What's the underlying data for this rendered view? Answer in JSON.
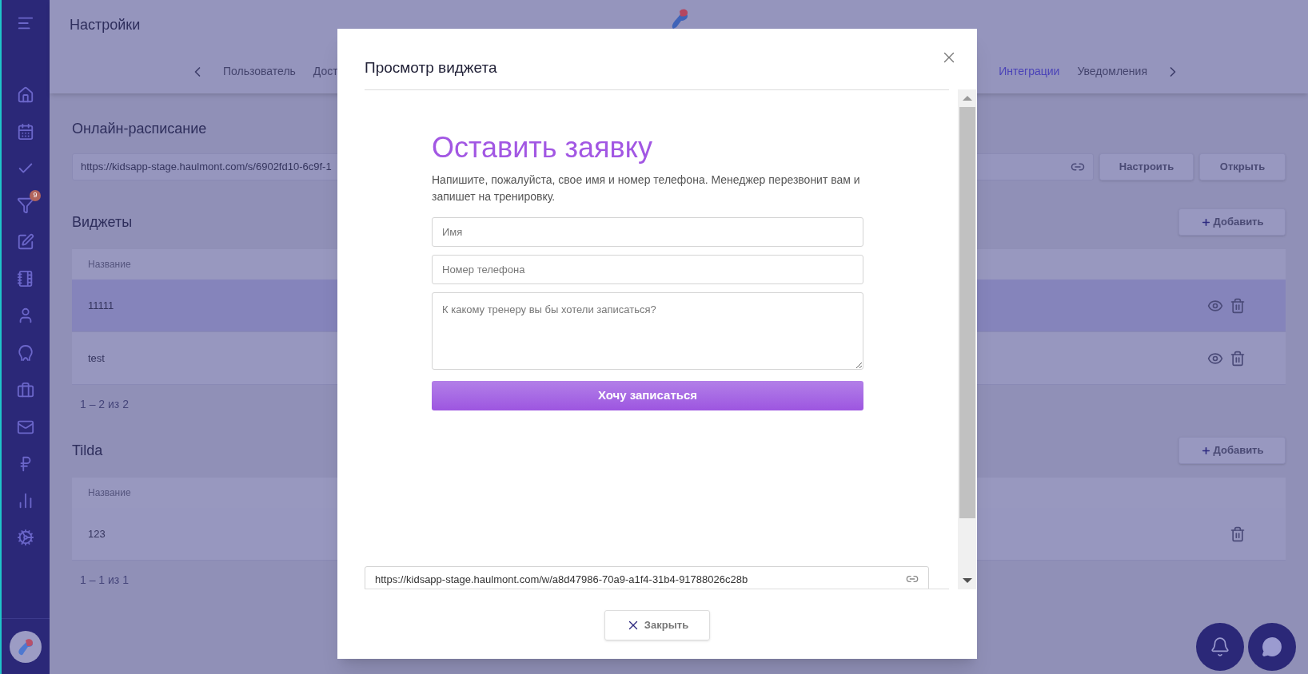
{
  "page": {
    "title": "Настройки"
  },
  "sidebar": {
    "badge": "9"
  },
  "tabs": [
    {
      "label": "Пользователь",
      "selected": false
    },
    {
      "label": "Дост",
      "selected": false
    },
    {
      "label": "Интеграции",
      "selected": true
    },
    {
      "label": "Уведомления",
      "selected": false
    }
  ],
  "online_schedule": {
    "title": "Онлайн-расписание",
    "url": "https://kidsapp-stage.haulmont.com/s/6902fd10-6c9f-1",
    "buttons": [
      "Настроить",
      "Открыть"
    ]
  },
  "widgets": {
    "title": "Виджеты",
    "add_button": "Добавить",
    "column": "Название",
    "pagination": "1 – 2 из 2",
    "rows": [
      {
        "name": "11111",
        "selected": true,
        "kind": "widget"
      },
      {
        "name": "test",
        "selected": false,
        "kind": "widget"
      }
    ]
  },
  "tilda": {
    "title": "Tilda",
    "add_button": "Добавить",
    "column": "Название",
    "pagination": "1 – 1 из 1",
    "rows": [
      {
        "name": "123",
        "selected": false,
        "kind": "tilda"
      }
    ]
  },
  "modal": {
    "title": "Просмотр виджета",
    "heading": "Оставить заявку",
    "text": "Напишите, пожалуйста, свое имя и номер телефона. Менеджер перезвонит вам и запишет на тренировку.",
    "fields": [
      {
        "placeholder": "Имя",
        "kind": "input"
      },
      {
        "placeholder": "Номер телефона",
        "kind": "input"
      },
      {
        "placeholder": "К какому тренеру вы бы хотели записаться?",
        "kind": "textarea"
      }
    ],
    "submit": "Хочу записаться",
    "link": "https://kidsapp-stage.haulmont.com/w/a8d47986-70a9-a1f4-31b4-91788026c28b",
    "close_button": "Закрыть"
  }
}
